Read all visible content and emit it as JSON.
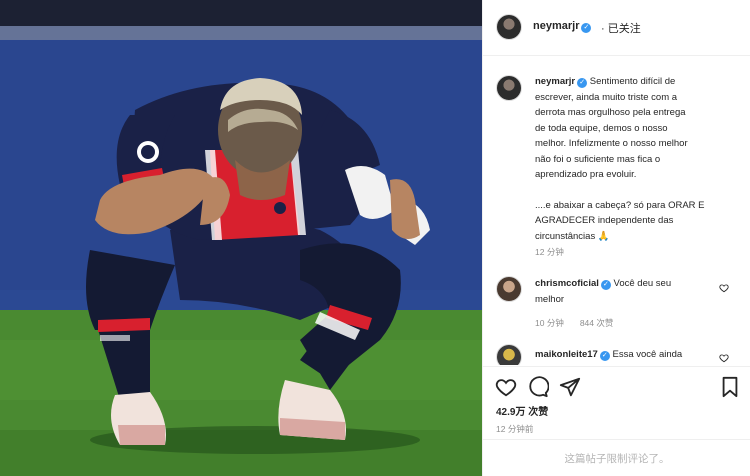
{
  "post": {
    "author": "neymarjr",
    "follow_status": "· 已关注",
    "caption_lines": [
      "Sentimento difícil de",
      "escrever, ainda muito triste com a",
      "derrota mas orgulhoso pela entrega",
      "de toda equipe, demos o nosso",
      "melhor. Infelizmente o nosso melhor",
      "não foi o suficiente mas fica o",
      "aprendizado pra evoluir."
    ],
    "caption_lines_2": [
      "....e abaixar a cabeça? só para ORAR E",
      "AGRADECER independente das",
      "circunstâncias 🙏"
    ],
    "caption_time": "12 分钟",
    "likes": "42.9万 次赞",
    "post_time": "12 分钟前",
    "comments_restricted": "这篇帖子限制评论了。"
  },
  "comments": [
    {
      "user": "chrismcoficial",
      "text_line1": "Você deu seu",
      "text_line2": "melhor",
      "time": "10 分钟",
      "likes": "844 次赞"
    },
    {
      "user": "maikonleite17",
      "text_line1": "Essa você ainda"
    }
  ],
  "icons": {
    "like": "heart-icon",
    "comment": "comment-icon",
    "share": "send-icon",
    "save": "bookmark-icon",
    "verified": "verified-badge-icon"
  },
  "colors": {
    "verified": "#3897f0",
    "meta_text": "#8e8e8e",
    "jersey": "#1a2147",
    "jersey_stripe": "#d8202e"
  }
}
